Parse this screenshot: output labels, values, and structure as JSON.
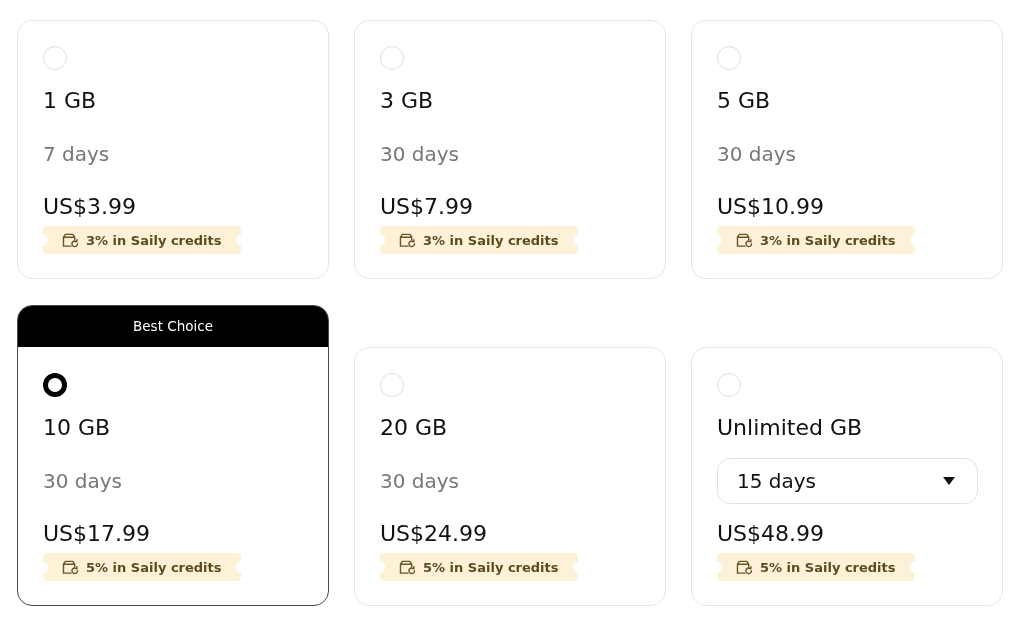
{
  "plans": [
    {
      "kind": "fixed",
      "selected": false,
      "data": "1 GB",
      "validity": "7 days",
      "price": "US$3.99",
      "credits": "3% in Saily credits"
    },
    {
      "kind": "fixed",
      "selected": false,
      "data": "3 GB",
      "validity": "30 days",
      "price": "US$7.99",
      "credits": "3% in Saily credits"
    },
    {
      "kind": "fixed",
      "selected": false,
      "data": "5 GB",
      "validity": "30 days",
      "price": "US$10.99",
      "credits": "3% in Saily credits"
    },
    {
      "kind": "fixed",
      "selected": true,
      "ribbon": "Best Choice",
      "data": "10 GB",
      "validity": "30 days",
      "price": "US$17.99",
      "credits": "5% in Saily credits"
    },
    {
      "kind": "fixed",
      "selected": false,
      "data": "20 GB",
      "validity": "30 days",
      "price": "US$24.99",
      "credits": "5% in Saily credits"
    },
    {
      "kind": "dropdown",
      "selected": false,
      "data": "Unlimited GB",
      "validity": "15 days",
      "price": "US$48.99",
      "credits": "5% in Saily credits"
    }
  ]
}
